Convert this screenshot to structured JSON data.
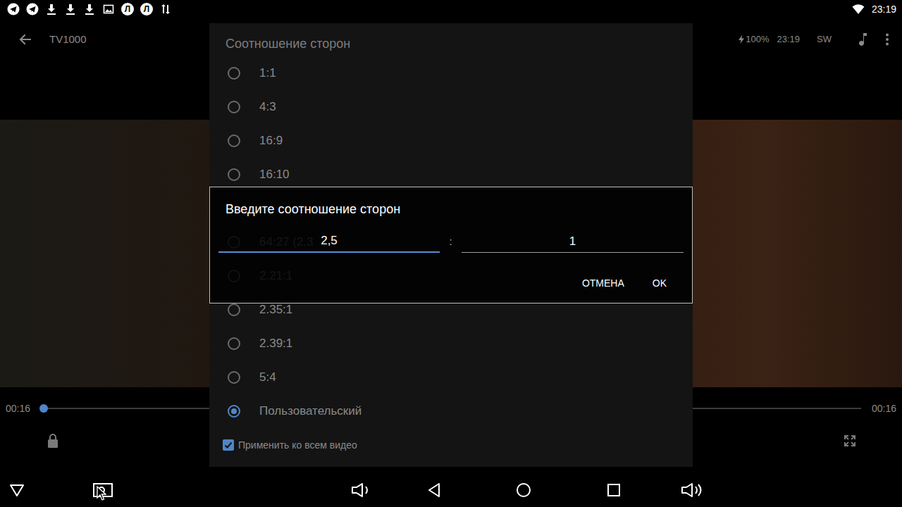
{
  "status_bar": {
    "badges": [
      "Л",
      "Л"
    ],
    "time": "23:19"
  },
  "player": {
    "title": "TV1000",
    "battery": "100%",
    "clock": "23:19",
    "decoder": "SW",
    "position": "00:16",
    "duration": "00:16",
    "progress": 0
  },
  "aspect_dialog": {
    "title": "Соотношение сторон",
    "options": [
      {
        "label": "1:1",
        "selected": false
      },
      {
        "label": "4:3",
        "selected": false
      },
      {
        "label": "16:9",
        "selected": false
      },
      {
        "label": "16:10",
        "selected": false
      },
      {
        "label": "64:27 (2.3",
        "selected": false
      },
      {
        "label": "2.21:1",
        "selected": false
      },
      {
        "label": "2.35:1",
        "selected": false
      },
      {
        "label": "2.39:1",
        "selected": false
      },
      {
        "label": "5:4",
        "selected": false
      },
      {
        "label": "Пользовательский",
        "selected": true
      }
    ],
    "apply_all": {
      "label": "Применить ко всем видео",
      "checked": true
    }
  },
  "input_dialog": {
    "title": "Введите соотношение сторон",
    "fields": [
      {
        "value": "2,5",
        "focused": true
      },
      {
        "value": "1",
        "focused": false
      }
    ],
    "separator": ":",
    "buttons": [
      "ОТМЕНА",
      "OK"
    ]
  }
}
